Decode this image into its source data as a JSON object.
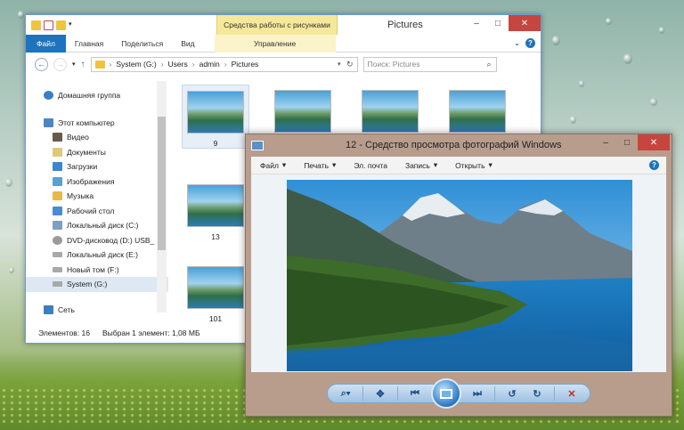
{
  "explorer": {
    "title": "Pictures",
    "context_tab_group": "Средства работы с рисунками",
    "tabs": [
      "Файл",
      "Главная",
      "Поделиться",
      "Вид"
    ],
    "context_tab": "Управление",
    "path": [
      "System (G:)",
      "Users",
      "admin",
      "Pictures"
    ],
    "search_placeholder": "Поиск: Pictures",
    "nav_items": [
      {
        "label": "Домашняя группа",
        "icon": "homegroup-icon"
      },
      {
        "label": "Этот компьютер",
        "icon": "computer-icon"
      },
      {
        "label": "Видео",
        "icon": "video-folder-icon"
      },
      {
        "label": "Документы",
        "icon": "documents-folder-icon"
      },
      {
        "label": "Загрузки",
        "icon": "downloads-folder-icon"
      },
      {
        "label": "Изображения",
        "icon": "pictures-folder-icon"
      },
      {
        "label": "Музыка",
        "icon": "music-folder-icon"
      },
      {
        "label": "Рабочий стол",
        "icon": "desktop-folder-icon"
      },
      {
        "label": "Локальный диск (C:)",
        "icon": "windows-drive-icon"
      },
      {
        "label": "DVD-дисковод (D:) USB_",
        "icon": "dvd-drive-icon"
      },
      {
        "label": "Локальный диск (E:)",
        "icon": "drive-icon"
      },
      {
        "label": "Новый том (F:)",
        "icon": "drive-icon"
      },
      {
        "label": "System (G:)",
        "icon": "drive-icon"
      },
      {
        "label": "Сеть",
        "icon": "network-icon"
      }
    ],
    "thumbnails": [
      "9",
      "13",
      "101"
    ],
    "status_count": "Элементов: 16",
    "status_selected": "Выбран 1 элемент: 1,08 МБ"
  },
  "viewer": {
    "title": "12 - Средство просмотра фотографий Windows",
    "menu": [
      "Файл",
      "Печать",
      "Эл. почта",
      "Запись",
      "Открыть"
    ],
    "toolbar_icons": [
      "zoom-icon",
      "actual-size-icon",
      "previous-icon",
      "slideshow-icon",
      "next-icon",
      "rotate-left-icon",
      "rotate-right-icon",
      "delete-icon"
    ]
  },
  "window_controls": {
    "minimize": "–",
    "maximize": "□",
    "close": "✕"
  }
}
